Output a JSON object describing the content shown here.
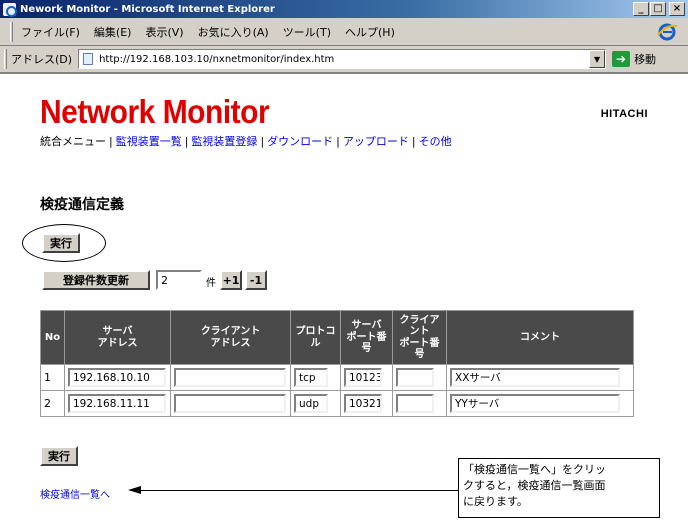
{
  "window": {
    "title": "Nework Monitor - Microsoft Internet Explorer",
    "buttons": {
      "minimize": "_",
      "maximize": "□",
      "close": "×"
    }
  },
  "menubar": [
    "ファイル(F)",
    "編集(E)",
    "表示(V)",
    "お気に入り(A)",
    "ツール(T)",
    "ヘルプ(H)"
  ],
  "addressbar": {
    "label": "アドレス(D)",
    "url": "http://192.168.103.10/nxnetmonitor/index.htm",
    "go_label": "移動",
    "go_icon": "go-arrow-icon"
  },
  "header": {
    "logo": "Network Monitor",
    "brand": "HITACHI",
    "nav_prefix": "統合メニュー",
    "nav_links": [
      "監視装置一覧",
      "監視装置登録",
      "ダウンロード",
      "アップロード",
      "その他"
    ]
  },
  "page": {
    "title": "検疫通信定義",
    "exec_label": "実行",
    "update_label": "登録件数更新",
    "count_value": "2",
    "count_unit": "件",
    "plus_label": "+1",
    "minus_label": "-1"
  },
  "table": {
    "headers": [
      "No",
      "サーバ\nアドレス",
      "クライアント\nアドレス",
      "プロトコ\nル",
      "サーバ\nポート番\n号",
      "クライア\nント\nポート番\n号",
      "コメント"
    ],
    "rows": [
      {
        "no": "1",
        "server": "192.168.10.10",
        "client": "",
        "protocol": "tcp",
        "server_port": "10123",
        "client_port": "",
        "comment": "XXサーバ"
      },
      {
        "no": "2",
        "server": "192.168.11.11",
        "client": "",
        "protocol": "udp",
        "server_port": "10321",
        "client_port": "",
        "comment": "YYサーバ"
      }
    ]
  },
  "footer": {
    "exec_label": "実行",
    "back_link": "検疫通信一覧へ",
    "callout": "「検疫通信一覧へ」をクリッ\nクすると，検疫通信一覧画面\nに戻ります。"
  },
  "colors": {
    "logo": "#e00000",
    "link": "#0000ee",
    "table_header": "#4a4a4a",
    "chrome": "#d4d0c8",
    "titlebar": "#0a246a"
  }
}
